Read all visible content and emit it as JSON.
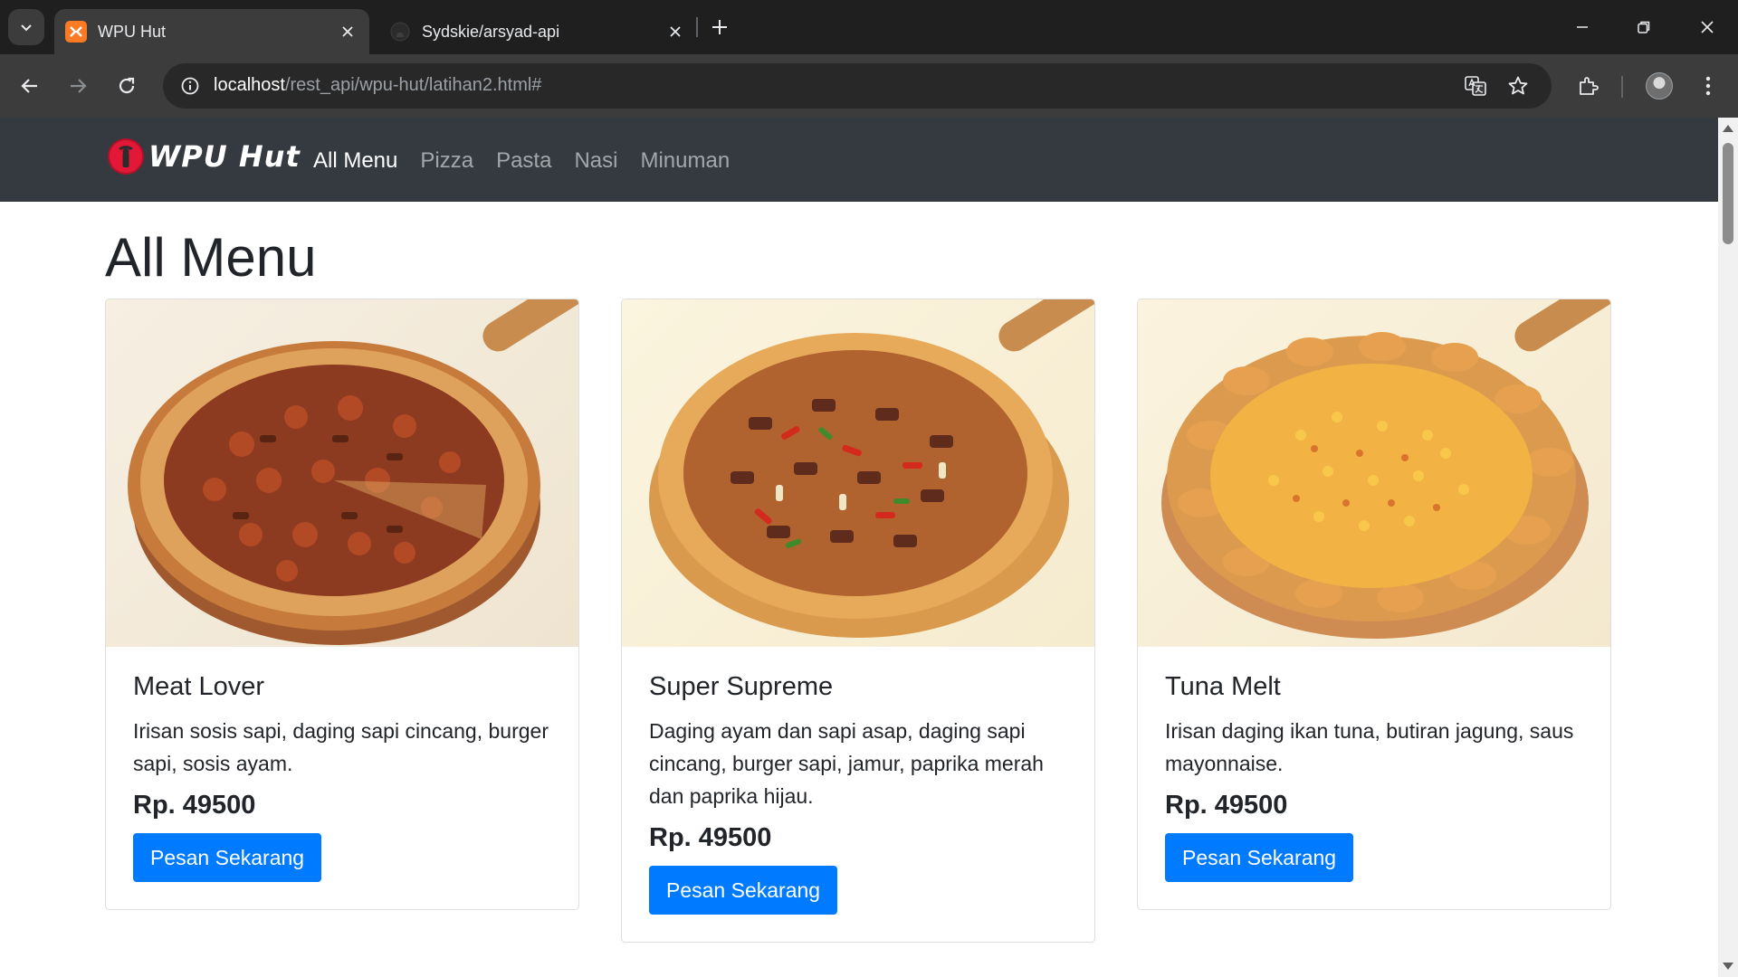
{
  "browser": {
    "tabs": [
      {
        "title": "WPU Hut",
        "favicon": "xampp-icon",
        "active": true
      },
      {
        "title": "Sydskie/arsyad-api",
        "favicon": "github-icon",
        "active": false
      }
    ],
    "url": {
      "host": "localhost",
      "path": "/rest_api/wpu-hut/latihan2.html#"
    }
  },
  "site": {
    "brand": "WPU Hut",
    "nav": [
      {
        "label": "All Menu",
        "active": true
      },
      {
        "label": "Pizza",
        "active": false
      },
      {
        "label": "Pasta",
        "active": false
      },
      {
        "label": "Nasi",
        "active": false
      },
      {
        "label": "Minuman",
        "active": false
      }
    ],
    "page_title": "All Menu"
  },
  "menu": [
    {
      "name": "Meat Lover",
      "description": "Irisan sosis sapi, daging sapi cincang, burger sapi, sosis ayam.",
      "price": "Rp. 49500",
      "button": "Pesan Sekarang"
    },
    {
      "name": "Super Supreme",
      "description": "Daging ayam dan sapi asap, daging sapi cincang, burger sapi, jamur, paprika merah dan paprika hijau.",
      "price": "Rp. 49500",
      "button": "Pesan Sekarang"
    },
    {
      "name": "Tuna Melt",
      "description": "Irisan daging ikan tuna, butiran jagung, saus mayonnaise.",
      "price": "Rp. 49500",
      "button": "Pesan Sekarang"
    }
  ],
  "colors": {
    "navbar": "#343a40",
    "primary_button": "#007bff",
    "tab_strip": "#1f1f1f",
    "toolbar": "#3c3c3c"
  }
}
